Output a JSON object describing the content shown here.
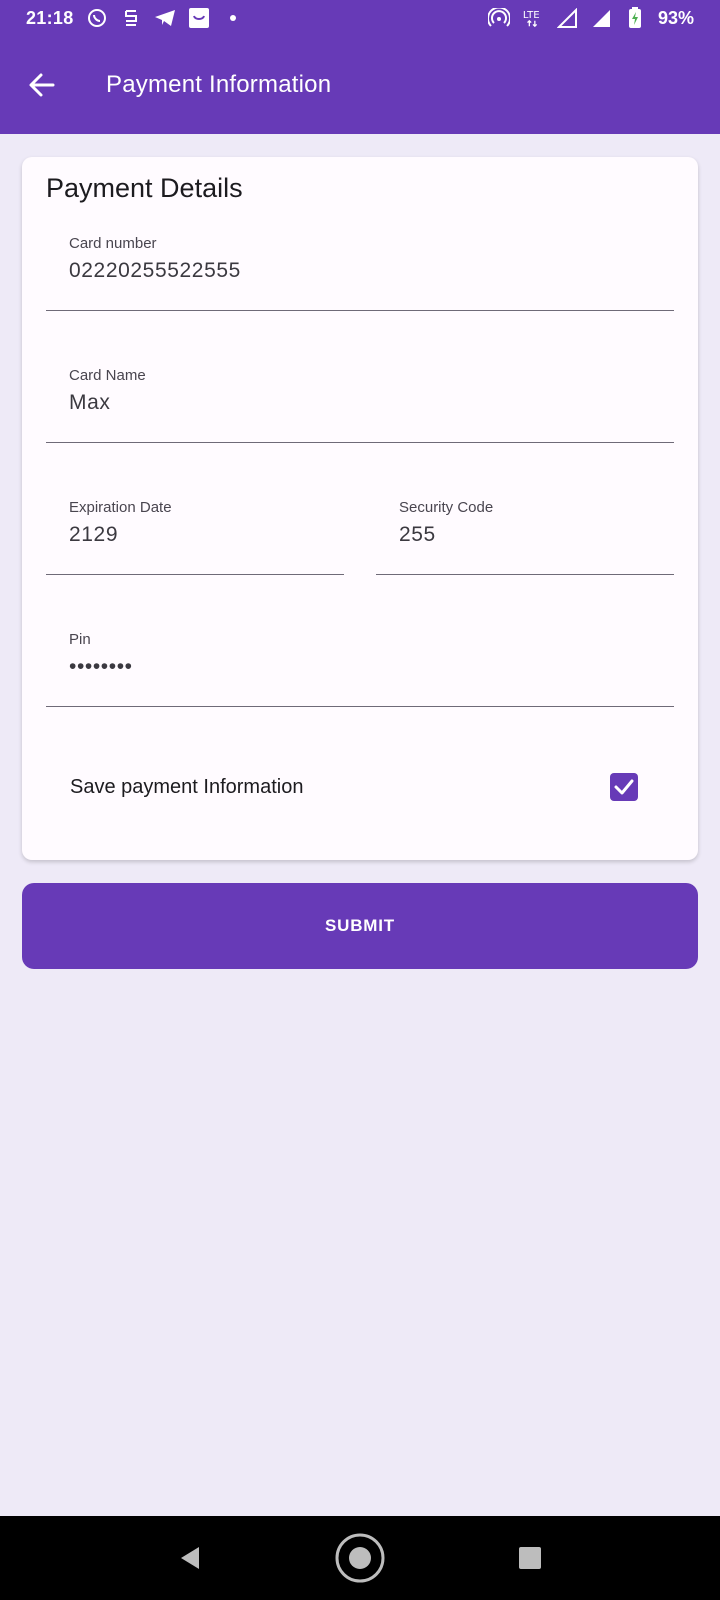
{
  "status_bar": {
    "time": "21:18",
    "battery": "93%",
    "icons": [
      "whatsapp-icon",
      "app-notification-icon",
      "telegram-icon",
      "shopping-bag-icon",
      "dot-icon",
      "hotspot-icon",
      "lte-icon",
      "signal-icon",
      "signal-icon",
      "battery-charging-icon"
    ]
  },
  "app_bar": {
    "title": "Payment Information",
    "back_icon": "arrow-left-icon"
  },
  "card": {
    "title": "Payment Details",
    "fields": {
      "card_number": {
        "label": "Card number",
        "value": "02220255522555"
      },
      "card_name": {
        "label": "Card Name",
        "value": "Max"
      },
      "expiration_date": {
        "label": "Expiration Date",
        "value": "2129"
      },
      "security_code": {
        "label": "Security Code",
        "value": "255"
      },
      "pin": {
        "label": "Pin",
        "value": "••••••••"
      }
    },
    "save_payment": {
      "label": "Save payment Information",
      "checked": true
    }
  },
  "submit_label": "SUBMIT",
  "colors": {
    "primary": "#673AB7",
    "background": "#EEEAF7",
    "card": "#FFFBFF"
  }
}
